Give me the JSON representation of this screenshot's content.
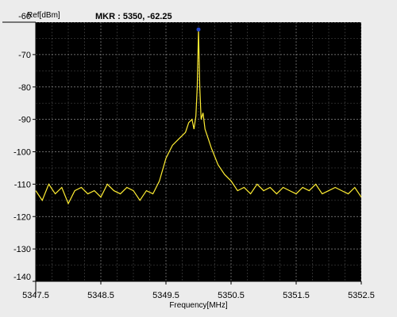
{
  "window": {
    "background": "#ececec"
  },
  "chart_data": {
    "type": "line",
    "title": "",
    "xlabel": "Frequency[MHz]",
    "ylabel": "Ref[dBm]",
    "xlim": [
      5347.5,
      5352.5
    ],
    "ylim": [
      -140,
      -60
    ],
    "xticks": [
      5347.5,
      5348.5,
      5349.5,
      5350.5,
      5351.5,
      5352.5
    ],
    "xtick_labels": [
      "5347.5",
      "5348.5",
      "5349.5",
      "5350.5",
      "5351.5",
      "5352.5"
    ],
    "yticks": [
      -60,
      -70,
      -80,
      -90,
      -100,
      -110,
      -120,
      -130,
      -140
    ],
    "ytick_labels": [
      "-60",
      "-70",
      "-80",
      "-90",
      "-100",
      "-110",
      "-120",
      "-130",
      "-140"
    ],
    "grid": true,
    "marker": {
      "label": "MKR :  5350, -62.25",
      "x": 5350.0,
      "y": -62.25,
      "color": "#2244cc"
    },
    "plot_background": "#000000",
    "grid_color": "#ffffff",
    "series": [
      {
        "color": "#ffee33",
        "x": [
          5347.5,
          5347.6,
          5347.7,
          5347.8,
          5347.9,
          5348.0,
          5348.1,
          5348.2,
          5348.3,
          5348.4,
          5348.5,
          5348.6,
          5348.7,
          5348.8,
          5348.9,
          5349.0,
          5349.1,
          5349.2,
          5349.3,
          5349.4,
          5349.5,
          5349.6,
          5349.7,
          5349.8,
          5349.85,
          5349.9,
          5349.93,
          5349.96,
          5349.98,
          5350.0,
          5350.02,
          5350.04,
          5350.07,
          5350.1,
          5350.15,
          5350.2,
          5350.3,
          5350.4,
          5350.5,
          5350.6,
          5350.7,
          5350.8,
          5350.9,
          5351.0,
          5351.1,
          5351.2,
          5351.3,
          5351.4,
          5351.5,
          5351.6,
          5351.7,
          5351.8,
          5351.9,
          5352.0,
          5352.1,
          5352.2,
          5352.3,
          5352.4,
          5352.5
        ],
        "y": [
          -112,
          -115,
          -110,
          -113,
          -111,
          -116,
          -112,
          -111,
          -113,
          -112,
          -114,
          -110,
          -112,
          -113,
          -111,
          -112,
          -115,
          -112,
          -113,
          -109,
          -102,
          -98,
          -96,
          -94,
          -91,
          -90,
          -93,
          -89,
          -80,
          -62.25,
          -80,
          -90,
          -88,
          -93,
          -96,
          -99,
          -104,
          -107,
          -109,
          -112,
          -111,
          -113,
          -110,
          -112,
          -111,
          -113,
          -111,
          -112,
          -113,
          -111,
          -112,
          -110,
          -113,
          -112,
          -111,
          -112,
          -113,
          -111,
          -114
        ]
      }
    ]
  }
}
